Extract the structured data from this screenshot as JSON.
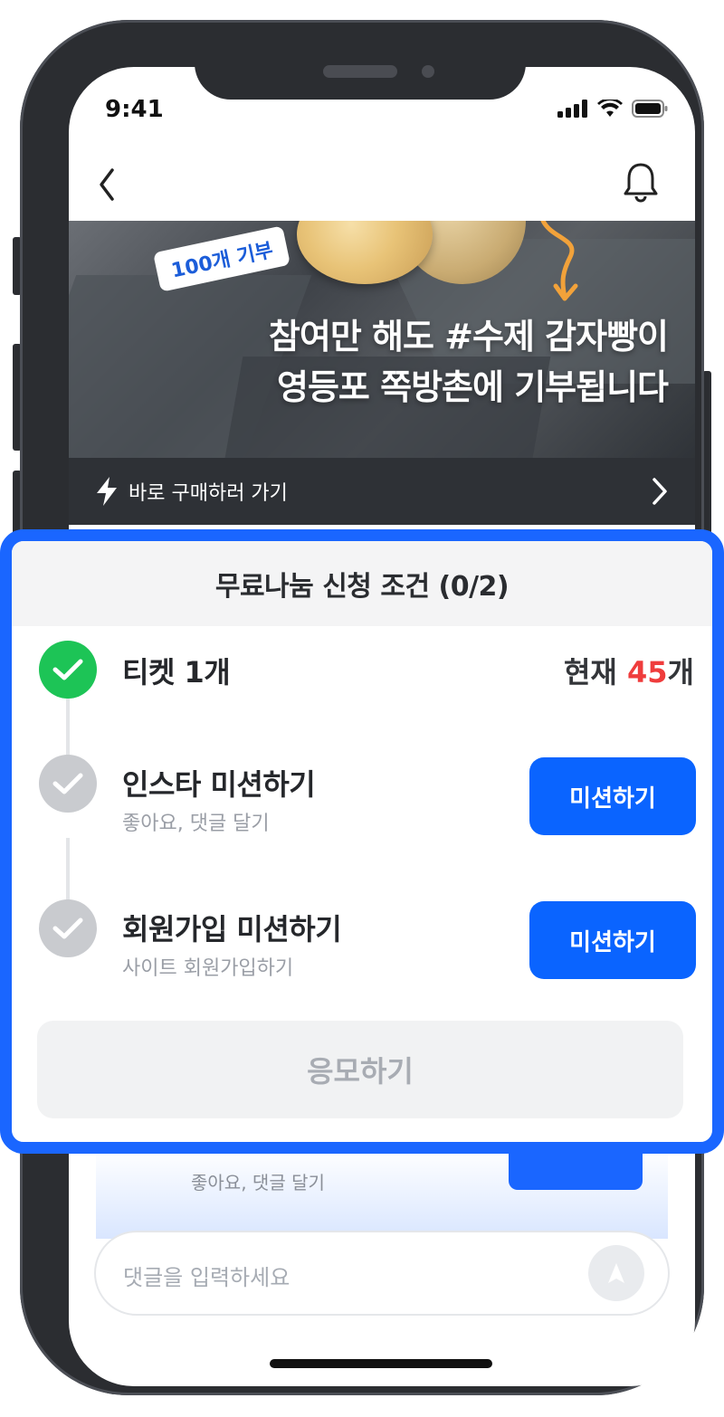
{
  "status_bar": {
    "time": "9:41"
  },
  "banner": {
    "tag": "100개 기부",
    "headline_line1": "참여만 해도 #수제 감자빵이",
    "headline_line2": "영등포 쪽방촌에 기부됩니다",
    "buy_label": "바로 구매하러 가기",
    "page_count": 4,
    "active_page": 1
  },
  "card": {
    "title": "무료나눔 신청 조건 (0/2)",
    "items": [
      {
        "title": "티켓 1개",
        "status": "done",
        "count_prefix": "현재 ",
        "count_value": "45",
        "count_suffix": "개"
      },
      {
        "title": "인스타 미션하기",
        "subtitle": "좋아요, 댓글 달기",
        "status": "todo",
        "button": "미션하기"
      },
      {
        "title": "회원가입 미션하기",
        "subtitle": "사이트 회원가입하기",
        "status": "todo",
        "button": "미션하기"
      }
    ],
    "apply_label": "응모하기"
  },
  "background_peek": {
    "subtitle": "좋아요, 댓글 달기"
  },
  "comment": {
    "placeholder": "댓글을 입력하세요"
  },
  "colors": {
    "accent": "#0a64ff",
    "success": "#1dc456",
    "count_highlight": "#ef3c3c"
  },
  "icons": [
    "chevron-left-icon",
    "bell-icon",
    "bolt-icon",
    "chevron-right-icon",
    "check-icon",
    "send-icon",
    "signal-icon",
    "wifi-icon",
    "battery-icon"
  ]
}
